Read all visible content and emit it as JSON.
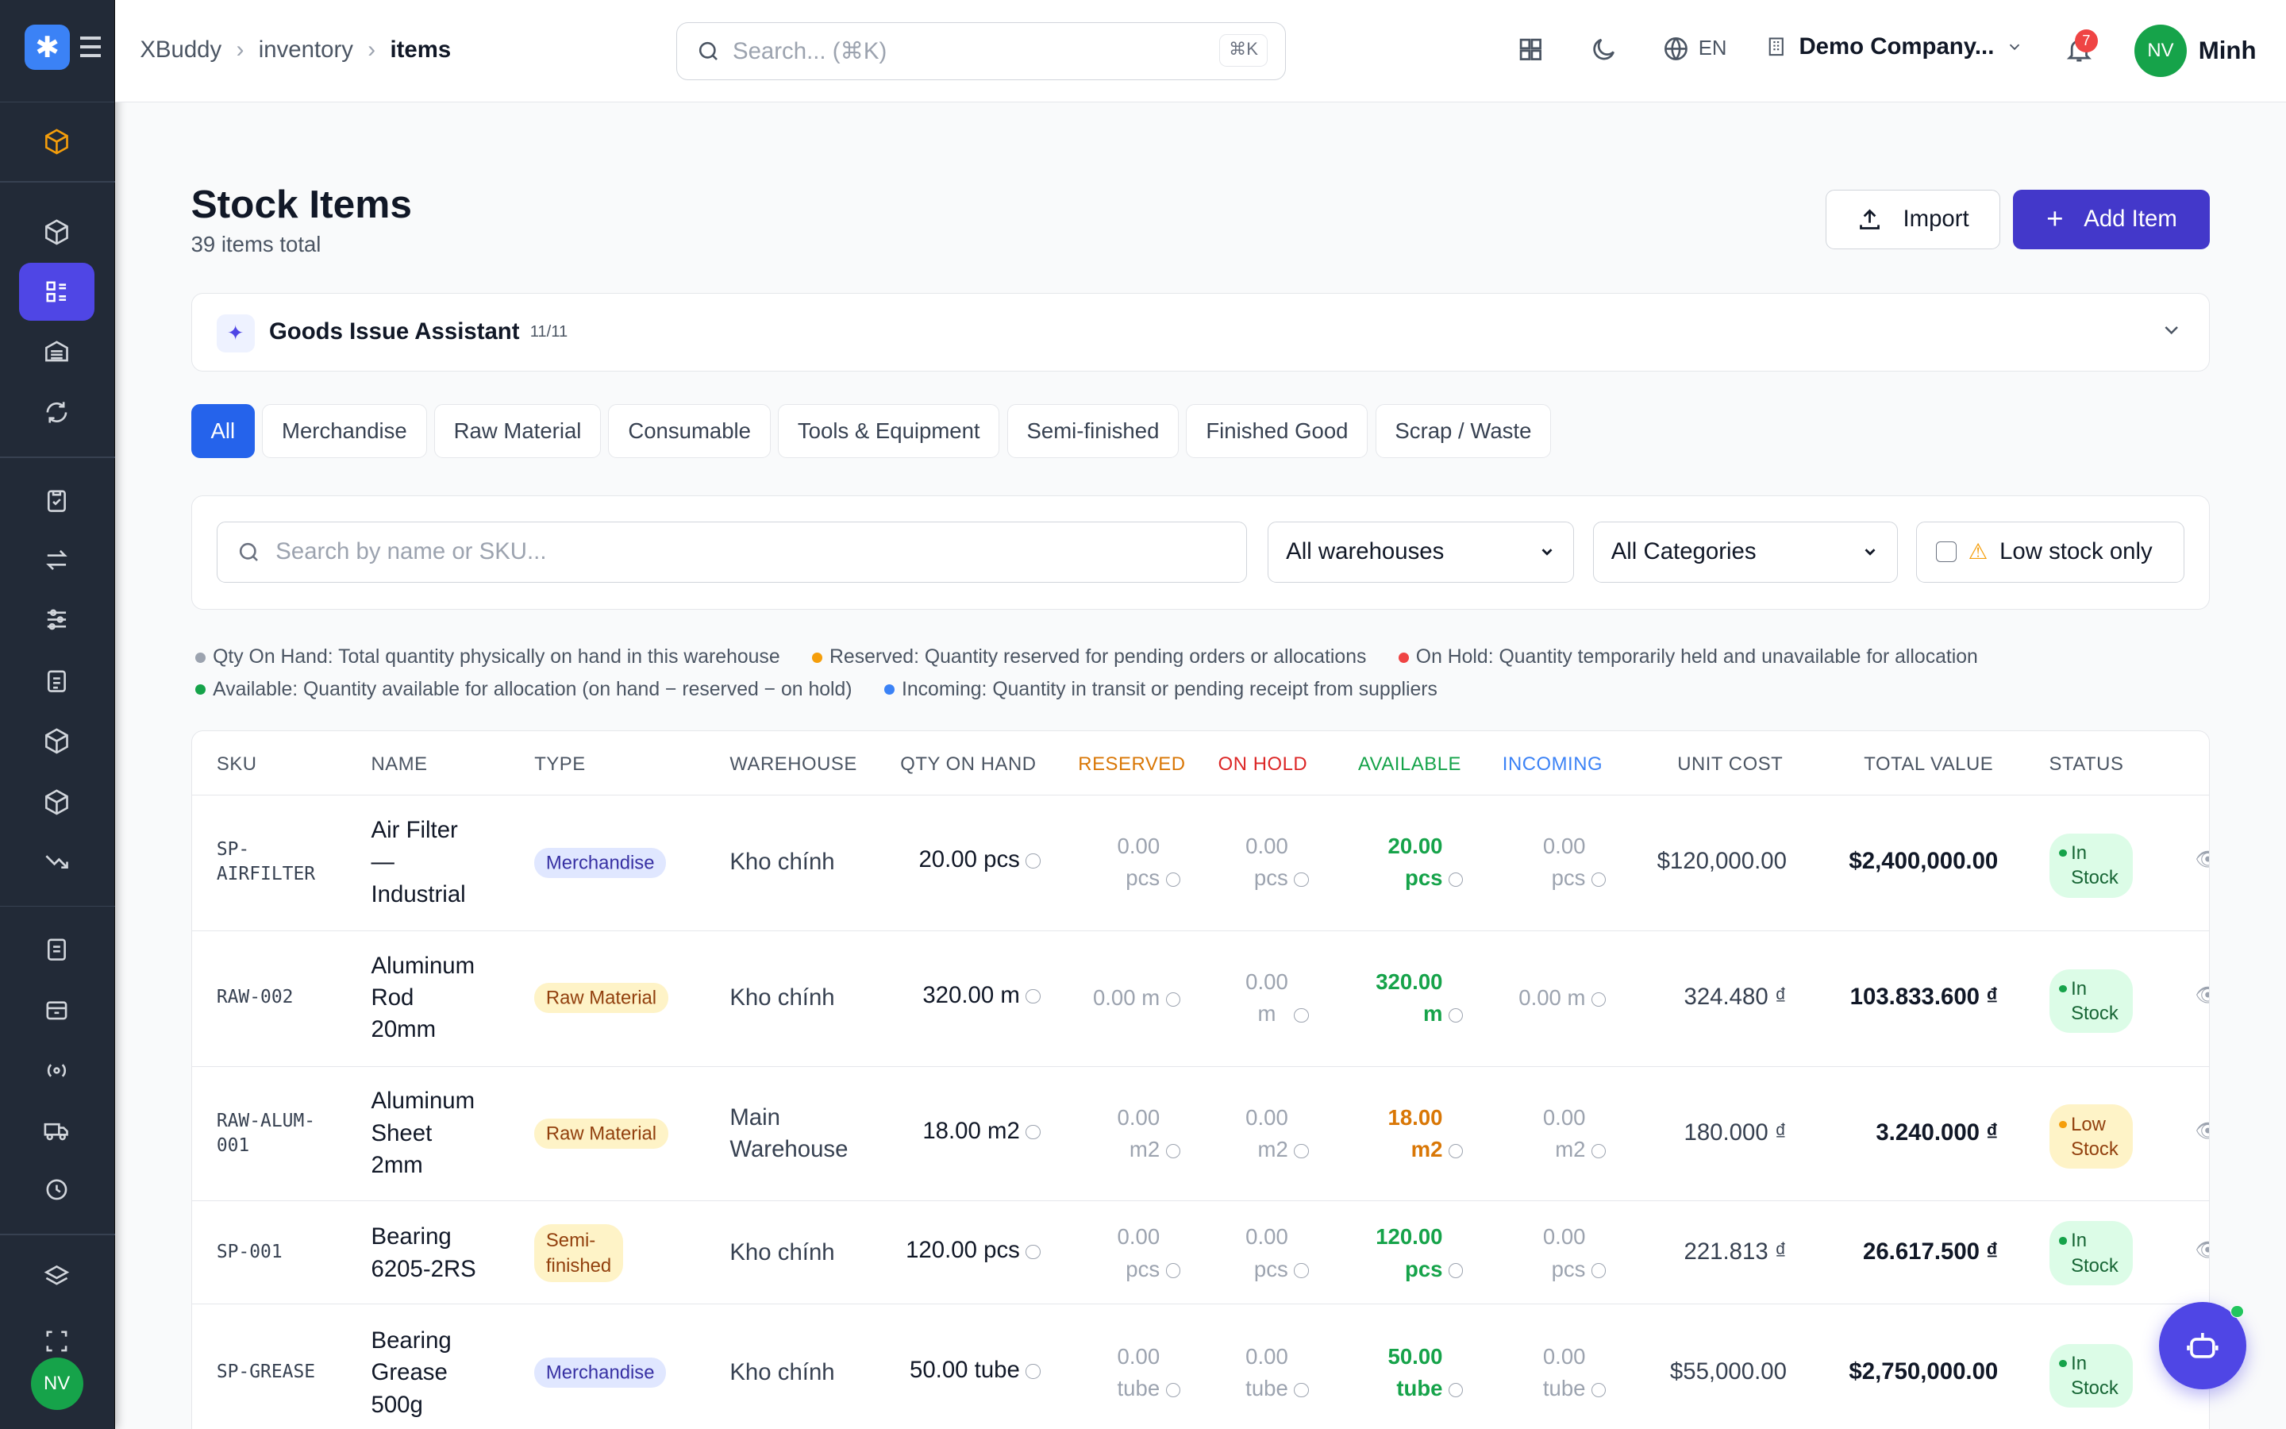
{
  "header": {
    "breadcrumbs": [
      "XBuddy",
      "inventory",
      "items"
    ],
    "search_placeholder": "Search... (⌘K)",
    "search_kbd": "⌘K",
    "lang": "EN",
    "company": "Demo Company...",
    "notif_count": "7",
    "user_initials": "NV",
    "user_name": "Minh"
  },
  "sidebar": {
    "user_initials": "NV"
  },
  "page": {
    "title": "Stock Items",
    "subtitle": "39 items total",
    "import_label": "Import",
    "add_label": "Add Item"
  },
  "assistant": {
    "title": "Goods Issue Assistant",
    "count": "11/11"
  },
  "tabs": [
    "All",
    "Merchandise",
    "Raw Material",
    "Consumable",
    "Tools & Equipment",
    "Semi-finished",
    "Finished Good",
    "Scrap / Waste"
  ],
  "filters": {
    "search_placeholder": "Search by name or SKU...",
    "warehouse": "All warehouses",
    "category": "All Categories",
    "low_stock": "Low stock only"
  },
  "legend": [
    {
      "text": "Qty On Hand: Total quantity physically on hand in this warehouse",
      "color": "#9ca3af"
    },
    {
      "text": "Reserved: Quantity reserved for pending orders or allocations",
      "color": "#f59e0b"
    },
    {
      "text": "On Hold: Quantity temporarily held and unavailable for allocation",
      "color": "#ef4444"
    },
    {
      "text": "Available: Quantity available for allocation (on hand − reserved − on hold)",
      "color": "#16a34a"
    },
    {
      "text": "Incoming: Quantity in transit or pending receipt from suppliers",
      "color": "#3b82f6"
    }
  ],
  "columns": [
    "SKU",
    "NAME",
    "TYPE",
    "WAREHOUSE",
    "QTY ON HAND",
    "RESERVED",
    "ON HOLD",
    "AVAILABLE",
    "INCOMING",
    "UNIT COST",
    "TOTAL VALUE",
    "STATUS"
  ],
  "rows": [
    {
      "sku1": "SP-",
      "sku2": "AIRFILTER",
      "n1": "Air Filter",
      "n2": "—",
      "n3": "Industrial",
      "type": "Merchandise",
      "wh1": "Kho chính",
      "wh2": "",
      "qty": "20.00 pcs",
      "res1": "0.00",
      "res2": "pcs",
      "hold1": "0.00",
      "hold2": "pcs",
      "av1": "20.00",
      "av2": "pcs",
      "inc1": "0.00",
      "inc2": "pcs",
      "cost": "$120,000.00",
      "value": "$2,400,000.00",
      "st1": "In",
      "st2": "Stock"
    },
    {
      "sku1": "RAW-002",
      "sku2": "",
      "n1": "Aluminum",
      "n2": "Rod",
      "n3": "20mm",
      "type": "Raw Material",
      "wh1": "Kho chính",
      "wh2": "",
      "qty": "320.00 m",
      "res1": "0.00 m",
      "res2": "",
      "hold1": "0.00",
      "hold2": "m",
      "av1": "320.00",
      "av2": "m",
      "inc1": "0.00 m",
      "inc2": "",
      "cost": "324.480 ₫",
      "value": "103.833.600 ₫",
      "st1": "In",
      "st2": "Stock"
    },
    {
      "sku1": "RAW-ALUM-",
      "sku2": "001",
      "n1": "Aluminum",
      "n2": "Sheet",
      "n3": "2mm",
      "type": "Raw Material",
      "wh1": "Main",
      "wh2": "Warehouse",
      "qty": "18.00 m2",
      "res1": "0.00",
      "res2": "m2",
      "hold1": "0.00",
      "hold2": "m2",
      "av1": "18.00",
      "av2": "m2",
      "inc1": "0.00",
      "inc2": "m2",
      "cost": "180.000 ₫",
      "value": "3.240.000 ₫",
      "st1": "Low",
      "st2": "Stock"
    },
    {
      "sku1": "SP-001",
      "sku2": "",
      "n1": "Bearing",
      "n2": "6205-2RS",
      "n3": "",
      "type1": "Semi-",
      "type2": "finished",
      "wh1": "Kho chính",
      "wh2": "",
      "qty": "120.00 pcs",
      "res1": "0.00",
      "res2": "pcs",
      "hold1": "0.00",
      "hold2": "pcs",
      "av1": "120.00",
      "av2": "pcs",
      "inc1": "0.00",
      "inc2": "pcs",
      "cost": "221.813 ₫",
      "value": "26.617.500 ₫",
      "st1": "In",
      "st2": "Stock"
    },
    {
      "sku1": "SP-GREASE",
      "sku2": "",
      "n1": "Bearing",
      "n2": "Grease",
      "n3": "500g",
      "type": "Merchandise",
      "wh1": "Kho chính",
      "wh2": "",
      "qty": "50.00 tube",
      "res1": "0.00",
      "res2": "tube",
      "hold1": "0.00",
      "hold2": "tube",
      "av1": "50.00",
      "av2": "tube",
      "inc1": "0.00",
      "inc2": "tube",
      "cost": "$55,000.00",
      "value": "$2,750,000.00",
      "st1": "In",
      "st2": "Stock"
    }
  ]
}
